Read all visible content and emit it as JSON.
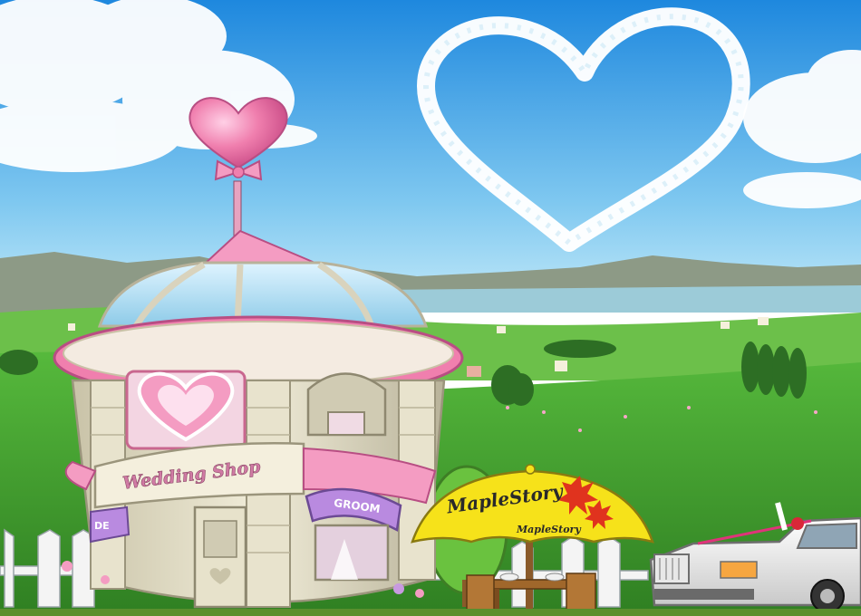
{
  "shop": {
    "sign": "Wedding Shop",
    "awning_right": "GROOM",
    "awning_left": "DE"
  },
  "umbrella": {
    "brand": "MapleStory",
    "brand_small": "MapleStory"
  },
  "colors": {
    "sky_top": "#1e8fe0",
    "sky_bottom": "#a9dcf5",
    "grass": "#3d9a2c",
    "pink": "#f07fae",
    "awning_purple": "#b98ae0",
    "umbrella_yellow": "#f6e21a",
    "maple_red": "#e0331e"
  }
}
